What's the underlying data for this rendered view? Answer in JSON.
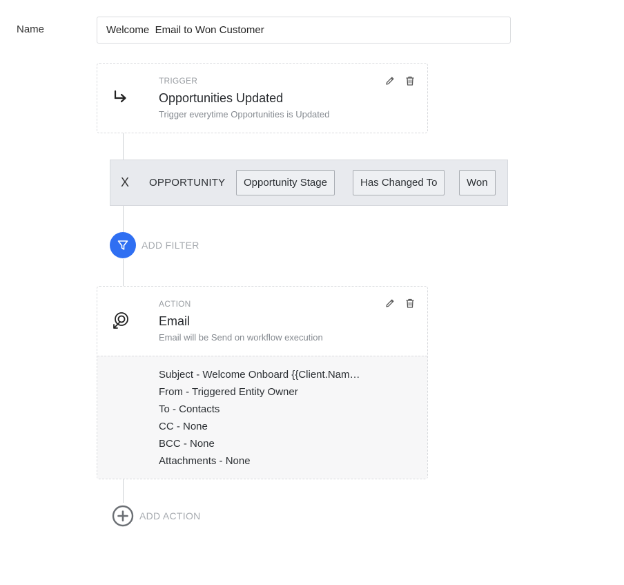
{
  "form": {
    "name_label": "Name",
    "name_value": "Welcome  Email to Won Customer"
  },
  "trigger": {
    "kicker": "TRIGGER",
    "title": "Opportunities Updated",
    "subtitle": "Trigger everytime Opportunities is Updated",
    "icon": "trigger-arrow-icon"
  },
  "filter": {
    "remove_label": "X",
    "entity": "OPPORTUNITY",
    "field": "Opportunity Stage",
    "operator": "Has Changed To",
    "value": "Won"
  },
  "add_filter": {
    "label": "ADD FILTER",
    "icon": "filter-funnel-icon",
    "accent": "#2f6ff2"
  },
  "action": {
    "kicker": "ACTION",
    "title": "Email",
    "subtitle": "Email will be Send on workflow execution",
    "icon": "email-action-icon",
    "details": [
      "Subject - Welcome Onboard {{Client.Name}}",
      "From - Triggered Entity Owner",
      "To - Contacts",
      "CC - None",
      "BCC - None",
      "Attachments - None"
    ]
  },
  "add_action": {
    "label": "ADD ACTION",
    "icon": "plus-circle-icon"
  }
}
